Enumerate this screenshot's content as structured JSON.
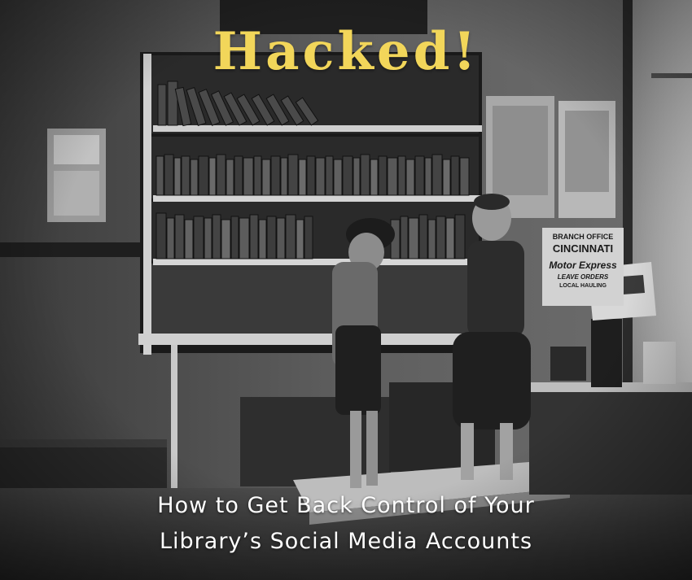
{
  "poster": {
    "title": "Hacked!",
    "subtitle_line1": "How to Get Back Control of Your",
    "subtitle_line2": "Library’s Social Media Accounts"
  },
  "sign": {
    "line1": "BRANCH OFFICE",
    "line2": "CINCINNATI",
    "line3": "Motor Express",
    "line4": "LEAVE ORDERS",
    "line5": "LOCAL HAULING"
  },
  "colors": {
    "title": "#f2d65a",
    "subtitle": "#ffffff"
  }
}
